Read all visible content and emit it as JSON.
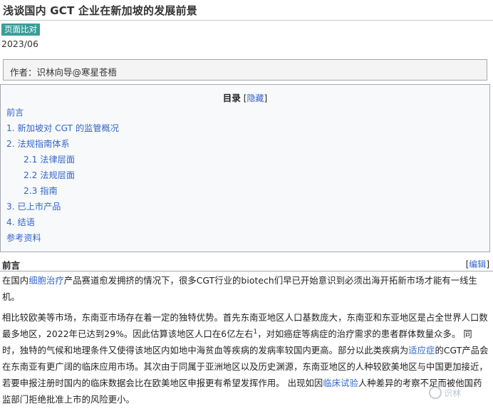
{
  "page": {
    "title": "浅谈国内 GCT 企业在新加坡的发展前景",
    "badge": "页面比对",
    "date": "2023/06",
    "author": "作者：识林向导@寒星苍梧"
  },
  "toc": {
    "title": "目录",
    "bracket_open": "[",
    "toggle": "隐藏",
    "bracket_close": "]",
    "items": [
      {
        "label": "前言"
      },
      {
        "label": "1. 新加坡对 CGT 的监管概况"
      },
      {
        "label": "2. 法规指南体系"
      },
      {
        "label": "2.1 法律层面"
      },
      {
        "label": "2.2 法规层面"
      },
      {
        "label": "2.3 指南"
      },
      {
        "label": "3. 已上市产品"
      },
      {
        "label": "4. 结语"
      },
      {
        "label": "参考资料"
      }
    ]
  },
  "section": {
    "heading": "前言",
    "edit_open": "[",
    "edit_label": "编辑",
    "edit_close": "]"
  },
  "paragraph1": {
    "pre": "在国内",
    "link": "细胞治疗",
    "post": "产品赛道愈发拥挤的情况下，很多CGT行业的biotech们早已开始意识到必须出海开拓新市场才能有一线生机。"
  },
  "paragraph2": {
    "part1": "相比较欧美等市场，东南亚市场存在着一定的独特优势。首先东南亚地区人口基数庞大，东南亚和东亚地区是占全世界人口数最多地区，2022年已达到29%。因此估算该地区人口在6亿左右",
    "sup": "1",
    "part2": "，对如癌症等病症的治疗需求的患者群体数量众多。 同时，独特的气候和地理条件又使得该地区内如地中海贫血等疾病的发病率较国内更高。部分以此类疾病为",
    "link1": "适应症",
    "part3": "的CGT产品会在东南亚有更广阔的临床应用市场。其次由于同属于亚洲地区以及历史渊源，东南亚地区的人种较欧美地区与中国更加接近，若要申报注册时国内的临床数据会比在欧美地区申报更有希望发挥作用。 出现如因",
    "link2": "临床试验",
    "part4": "人种差异的考察不足而被他国药监部门拒绝批准上市的风险更小。"
  },
  "watermark": {
    "text": "识林"
  }
}
